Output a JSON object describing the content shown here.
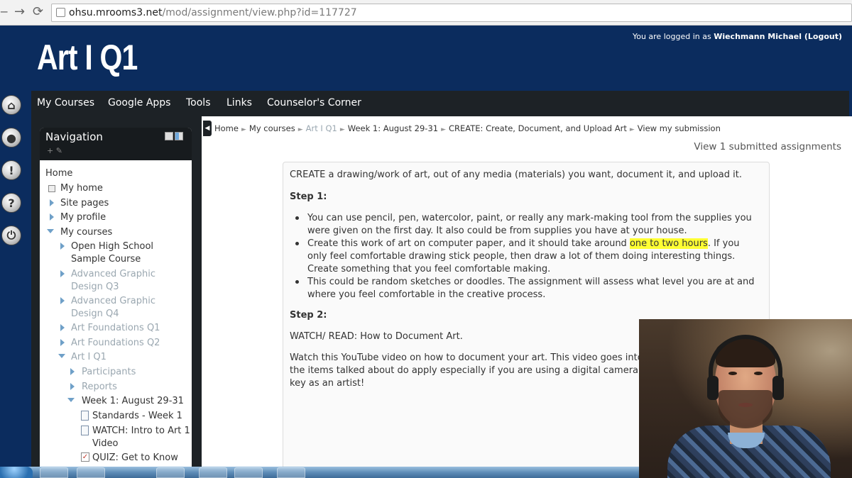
{
  "browser": {
    "back_icon": "back-arrow-icon",
    "forward_icon": "forward-arrow-icon",
    "reload_icon": "reload-icon",
    "url_host": "ohsu.mrooms3.net",
    "url_path": "/mod/assignment/view.php?id=117727"
  },
  "header": {
    "site_title": "Art I Q1",
    "login_prefix": "You are logged in as ",
    "user_name": "Wiechmann Michael",
    "logout_open": " (",
    "logout_label": "Logout",
    "logout_close": ")"
  },
  "dock": [
    "home-icon",
    "user-icon",
    "alert-icon",
    "help-icon",
    "power-icon"
  ],
  "menu": {
    "items": [
      "My Courses",
      "Google Apps",
      "Tools",
      "Links",
      "Counselor's Corner"
    ]
  },
  "navigation": {
    "title": "Navigation",
    "tools": "+ ✎",
    "items": {
      "home": "Home",
      "my_home": "My home",
      "site_pages": "Site pages",
      "my_profile": "My profile",
      "my_courses": "My courses",
      "open_high_1": "Open High School",
      "open_high_2": "Sample Course",
      "adv_q3_1": "Advanced Graphic",
      "adv_q3_2": "Design Q3",
      "adv_q4_1": "Advanced Graphic",
      "adv_q4_2": "Design Q4",
      "art_found_q1": "Art Foundations Q1",
      "art_found_q2": "Art Foundations Q2",
      "art_i_q1": "Art I Q1",
      "participants": "Participants",
      "reports": "Reports",
      "week1": "Week 1: August 29-31",
      "standards": "Standards - Week 1",
      "watch_1": "WATCH: Intro to Art 1",
      "watch_2": "Video",
      "quiz_1": "QUIZ: Get to Know"
    }
  },
  "breadcrumb": {
    "items": [
      "Home",
      "My courses",
      "Art I Q1",
      "Week 1: August 29-31",
      "CREATE: Create, Document, and Upload Art",
      "View my submission"
    ],
    "separator": "►"
  },
  "submitted_link": "View 1 submitted assignments",
  "assignment": {
    "intro": "CREATE a drawing/work of art, out of any media (materials) you want, document it, and upload it.",
    "step1": "Step 1:",
    "b1_l1": "You can use pencil, pen, watercolor, paint, or really any mark-making tool from the supplies you",
    "b1_l2": "were given on the first day. It also could be from supplies you have at your house.",
    "b2_l1_a": "Create this work of art on computer paper, and it should take around ",
    "b2_l1_hl": "one to two hours",
    "b2_l1_b": ". If you",
    "b2_l2": "only feel comfortable drawing stick people, then draw a lot of them doing interesting things.",
    "b2_l3": "Create something that you feel comfortable making.",
    "b3_l1": "This could be random sketches or doodles. The assignment will assess what level you are at and",
    "b3_l2": "where you feel comfortable in the creative process.",
    "step2": "Step 2:",
    "watch_read": "WATCH/ READ: How to Document Art.",
    "video_l1": "Watch this YouTube video on how to document your art. This video goes into",
    "video_l2": "the items talked about do apply especially if you are using a digital camera",
    "video_l3": "key as an artist!"
  },
  "colors": {
    "header_bg": "#0b2c5e",
    "menubar_bg": "#1d2226",
    "highlight": "#ffff33",
    "link_dim": "#9aa7b0"
  }
}
